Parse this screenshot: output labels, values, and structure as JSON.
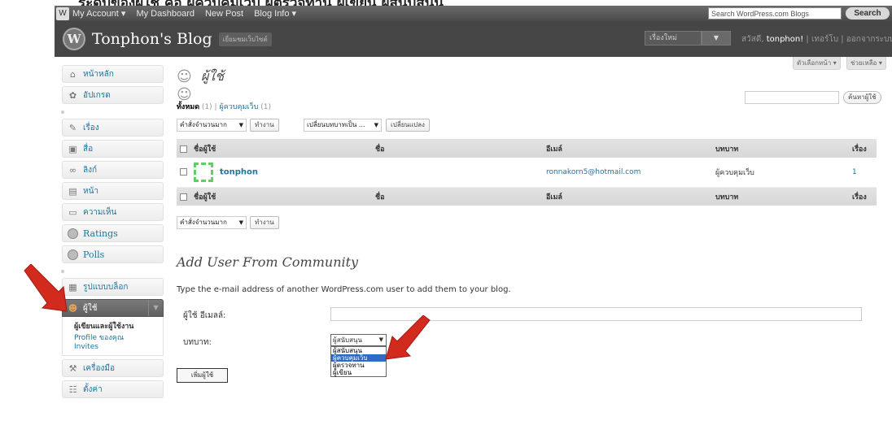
{
  "caption": "ระดับของผู้ใช้ คือ ผู้ควบคุมเว็บ ผู้ตรวจทาน ผู้เขียน ผู้สนับสนุน",
  "adminbar": {
    "items": [
      "My Account ▾",
      "My Dashboard",
      "New Post",
      "Blog Info ▾"
    ],
    "search_placeholder": "Search WordPress.com Blogs",
    "search_button": "Search"
  },
  "header": {
    "blog_title": "Tonphon's Blog",
    "visit_site": "เยี่ยมชมเว็บไซต์",
    "new_post": "เรื่องใหม่",
    "greeting_prefix": "สวัสดี,",
    "username": "tonphon!",
    "links": "| เทอร์โบ | ออกจากระบบ"
  },
  "screen_options": {
    "options": "ตัวเลือกหน้า ▾",
    "help": "ช่วยเหลือ ▾"
  },
  "sidebar": {
    "items": [
      {
        "label": "หน้าหลัก",
        "icon": "⌂"
      },
      {
        "label": "อัปเกรด",
        "icon": "✿"
      },
      {
        "label": "เรื่อง",
        "icon": "✎"
      },
      {
        "label": "สื่อ",
        "icon": "▣"
      },
      {
        "label": "ลิงก์",
        "icon": "∞"
      },
      {
        "label": "หน้า",
        "icon": "▤"
      },
      {
        "label": "ความเห็น",
        "icon": "▭"
      },
      {
        "label": "Ratings",
        "icon": ""
      },
      {
        "label": "Polls",
        "icon": ""
      },
      {
        "label": "รูปแบบบล็อก",
        "icon": "▦"
      },
      {
        "label": "ผู้ใช้",
        "icon": "☻"
      },
      {
        "label": "เครื่องมือ",
        "icon": "⚒"
      },
      {
        "label": "ตั้งค่า",
        "icon": "☷"
      }
    ],
    "submenu": [
      "ผู้เขียนและผู้ใช้งาน",
      "Profile ของคุณ",
      "Invites"
    ]
  },
  "main": {
    "page_title": "ผู้ใช้",
    "filter_all": "ทั้งหมด",
    "filter_all_count": "(1)",
    "filter_sep": "|",
    "filter_admin": "ผู้ควบคุมเว็บ",
    "filter_admin_count": "(1)",
    "search_button": "ค้นหาผู้ใช้",
    "bulk_action": "คำสั่งจำนวนมาก",
    "apply": "ทำงาน",
    "change_role": "เปลี่ยนบทบาทเป็น ...",
    "change": "เปลี่ยนแปลง",
    "columns": [
      "ชื่อผู้ใช้",
      "ชื่อ",
      "อีเมล์",
      "บทบาท",
      "เรื่อง"
    ],
    "rows": [
      {
        "username": "tonphon",
        "name": "",
        "email": "ronnakorn5@hotmail.com",
        "role": "ผู้ควบคุมเว็บ",
        "posts": "1"
      }
    ]
  },
  "add_user": {
    "title": "Add User From Community",
    "description": "Type the e-mail address of another WordPress.com user to add them to your blog.",
    "email_label": "ผู้ใช้ อีเมลล์:",
    "role_label": "บทบาท:",
    "role_selected": "ผู้สนับสนุน",
    "role_options": [
      "ผู้สนับสนุน",
      "ผู้ควบคุมเว็บ",
      "ผู้ตรวจทาน",
      "ผู้เขียน"
    ],
    "add_button": "เพิ่มผู้ใช้"
  },
  "colors": {
    "arrow": "#d32a1e",
    "link": "#21759b",
    "header": "#464646"
  }
}
